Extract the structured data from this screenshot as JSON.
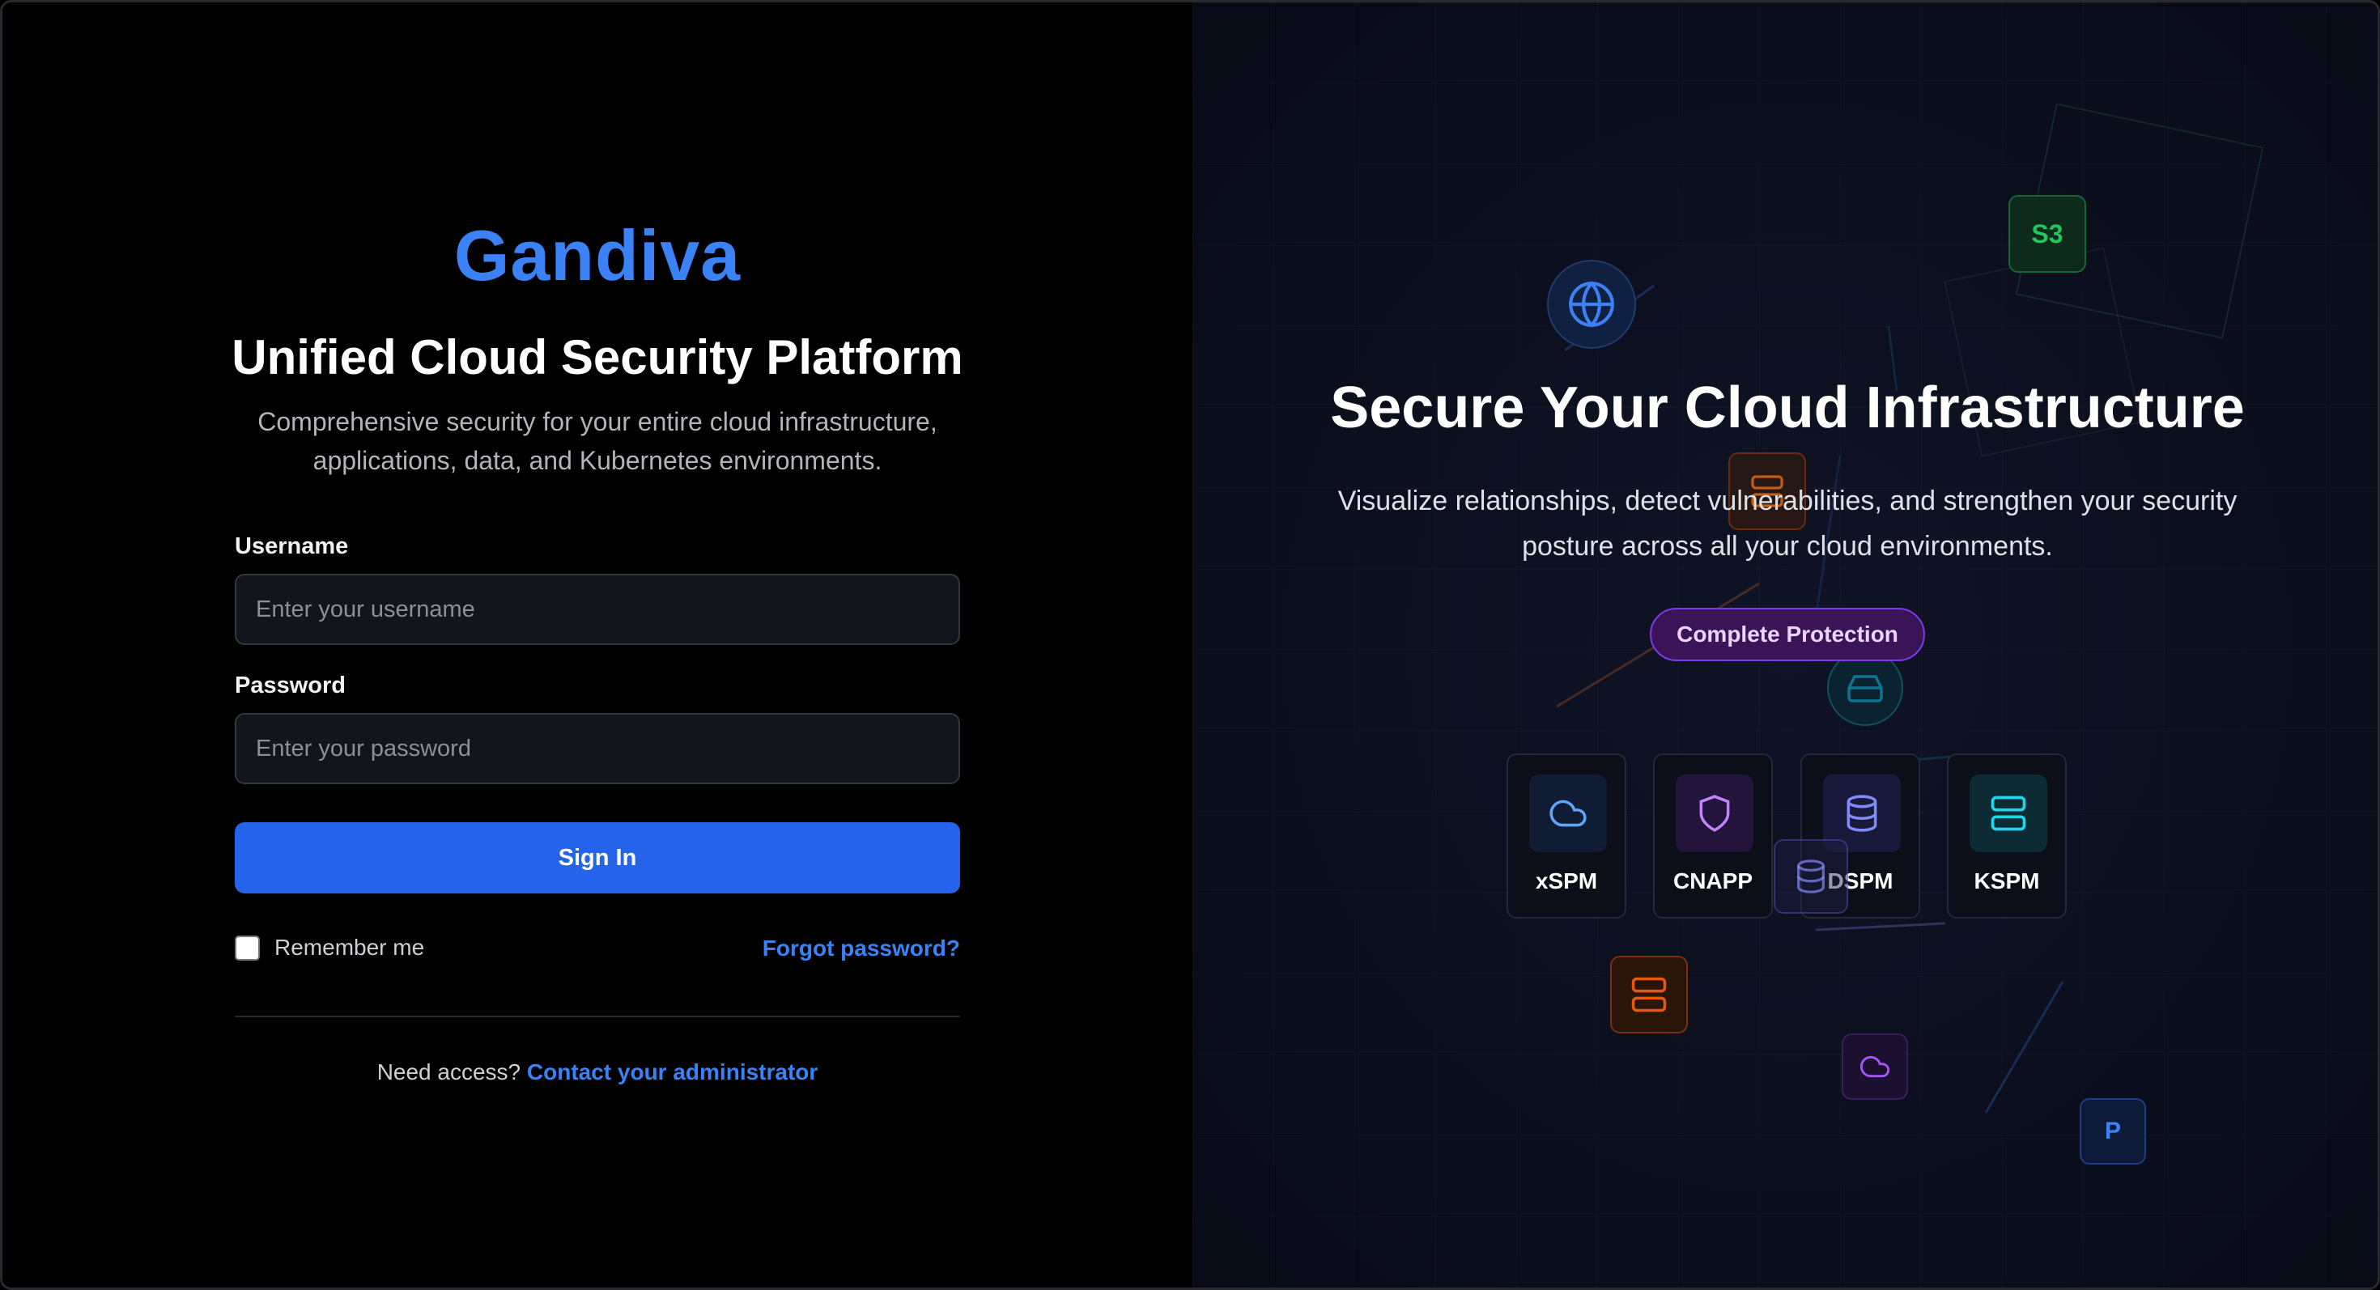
{
  "login": {
    "brand": "Gandiva",
    "headline": "Unified Cloud Security Platform",
    "subheadline": "Comprehensive security for your entire cloud infrastructure, applications, data, and Kubernetes environments.",
    "username_label": "Username",
    "username_placeholder": "Enter your username",
    "username_value": "",
    "password_label": "Password",
    "password_placeholder": "Enter your password",
    "password_value": "",
    "signin_label": "Sign In",
    "remember_label": "Remember me",
    "remember_checked": false,
    "forgot_label": "Forgot password?",
    "access_prefix": "Need access?",
    "access_link": "Contact your administrator"
  },
  "hero": {
    "title": "Secure Your Cloud Infrastructure",
    "subtitle": "Visualize relationships, detect vulnerabilities, and strengthen your security posture across all your cloud environments.",
    "badge": "Complete Protection",
    "products": [
      {
        "label": "xSPM",
        "icon": "cloud-icon",
        "color": "#60a5fa"
      },
      {
        "label": "CNAPP",
        "icon": "shield-icon",
        "color": "#c084fc"
      },
      {
        "label": "DSPM",
        "icon": "database-icon",
        "color": "#818cf8"
      },
      {
        "label": "KSPM",
        "icon": "server-icon",
        "color": "#22d3ee"
      }
    ],
    "floating": [
      {
        "label": "S3",
        "color": "#22c55e"
      },
      {
        "label": "P",
        "color": "#3b82f6"
      }
    ]
  },
  "colors": {
    "brand": "#3b82f6",
    "primary_button": "#2563eb",
    "badge_bg": "#3b1457",
    "badge_border": "#7c3aed"
  }
}
